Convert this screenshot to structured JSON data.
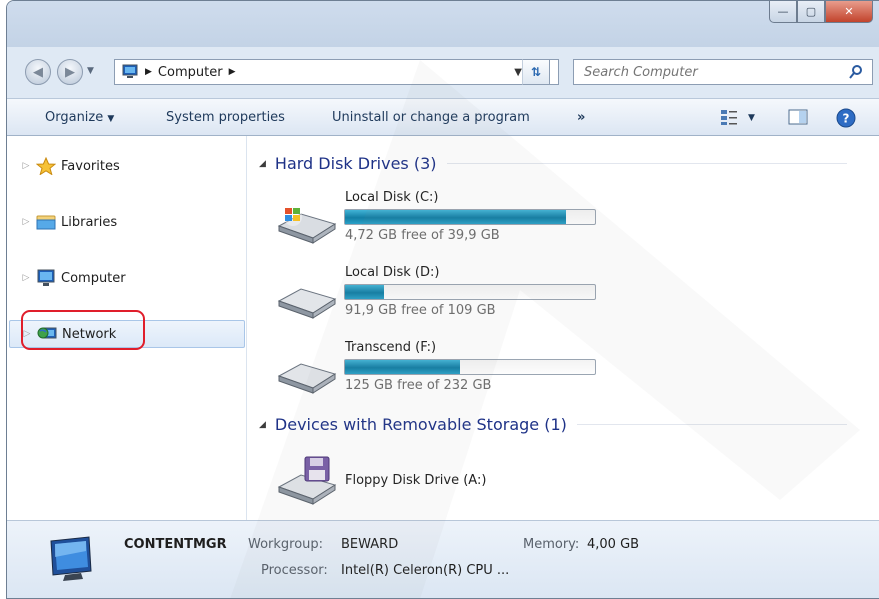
{
  "address": {
    "crumbs": [
      "Computer"
    ]
  },
  "search": {
    "placeholder": "Search Computer"
  },
  "toolbar": {
    "organize": "Organize",
    "system_properties": "System properties",
    "uninstall": "Uninstall or change a program",
    "more": "»"
  },
  "nav": {
    "items": [
      {
        "label": "Favorites",
        "icon": "star-icon"
      },
      {
        "label": "Libraries",
        "icon": "library-folder-icon"
      },
      {
        "label": "Computer",
        "icon": "computer-icon"
      },
      {
        "label": "Network",
        "icon": "network-icon",
        "selected": true,
        "circled": true
      }
    ]
  },
  "groups": {
    "hard_disks": "Hard Disk Drives (3)",
    "removable": "Devices with Removable Storage (1)"
  },
  "drives": [
    {
      "name": "Local Disk (C:)",
      "free_text": "4,72 GB free of 39,9 GB",
      "used_fraction": 0.882,
      "icon": "windows-drive-icon"
    },
    {
      "name": "Local Disk (D:)",
      "free_text": "91,9 GB free of 109 GB",
      "used_fraction": 0.157,
      "icon": "hard-drive-icon"
    },
    {
      "name": "Transcend (F:)",
      "free_text": "125 GB free of 232 GB",
      "used_fraction": 0.461,
      "icon": "hard-drive-icon"
    }
  ],
  "removable": [
    {
      "name": "Floppy Disk Drive (A:)",
      "icon": "floppy-drive-icon"
    }
  ],
  "details": {
    "computer_name": "CONTENTMGR",
    "workgroup_label": "Workgroup:",
    "workgroup": "BEWARD",
    "memory_label": "Memory:",
    "memory": "4,00 GB",
    "processor_label": "Processor:",
    "processor": "Intel(R) Celeron(R) CPU ..."
  },
  "colors": {
    "highlight_circle": "#e01e2b",
    "group_header": "#1e3287",
    "usage_bar": "#1a8cb5"
  }
}
